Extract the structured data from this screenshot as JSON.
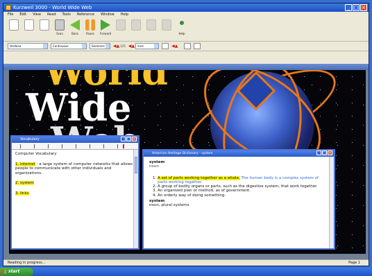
{
  "app": {
    "title": "Kurzweil 3000 - World Wide Web"
  },
  "menu": [
    "File",
    "Edit",
    "View",
    "Read",
    "Tools",
    "Reference",
    "Window",
    "Help"
  ],
  "toolbar": [
    {
      "icon": "document-icon",
      "label": ""
    },
    {
      "icon": "document-icon",
      "label": ""
    },
    {
      "icon": "document-icon",
      "label": ""
    },
    {
      "icon": "print-icon",
      "label": "Scan"
    },
    {
      "icon": "back-icon",
      "label": "Back"
    },
    {
      "icon": "pause-icon",
      "label": "Pause"
    },
    {
      "icon": "forward-icon",
      "label": "Forward"
    },
    {
      "icon": "disabled-icon",
      "label": ""
    },
    {
      "icon": "disabled-icon",
      "label": ""
    },
    {
      "icon": "disabled-icon",
      "label": ""
    },
    {
      "icon": "disabled-icon",
      "label": ""
    },
    {
      "icon": "help-icon",
      "label": "Help"
    }
  ],
  "format_bar": {
    "font": "Verdana",
    "mode": "Continuous",
    "unit": "Sentence",
    "speed": "125",
    "voice": "Kate"
  },
  "vocab_window": {
    "title": "Vocabulary",
    "heading": "Computer Vocabulary",
    "items": [
      {
        "term": "1. internet",
        "definition": " - a large system of computer networks that allows people to communicate with other individuals and organizations."
      },
      {
        "term": "2. system",
        "definition": ""
      },
      {
        "term": "3. links",
        "definition": ""
      }
    ]
  },
  "dict_window": {
    "title": "American Heritage Dictionary - system",
    "headword": "system",
    "pos": "noun",
    "senses": [
      {
        "text": "A set of parts working together as a whole.",
        "highlighted": true,
        "example": "The human body is a complex system of parts working together."
      },
      {
        "text": "A group of bodily organs or parts, such as the digestive system, that work together.",
        "highlighted": false,
        "example": ""
      },
      {
        "text": "An organized plan or method, as of government.",
        "highlighted": false,
        "example": ""
      },
      {
        "text": "An orderly way of doing something.",
        "highlighted": false,
        "example": ""
      }
    ],
    "plural_label": "system",
    "plural_text": "noun, plural systems"
  },
  "status": {
    "left": "Reading in progress...",
    "right": "Page 1"
  },
  "taskbar": {
    "start_label": "start"
  },
  "colors": {
    "highlight": "#f6f21c",
    "title_blue": "#2c5ccb",
    "taskbar_green": "#2e8b2b"
  }
}
